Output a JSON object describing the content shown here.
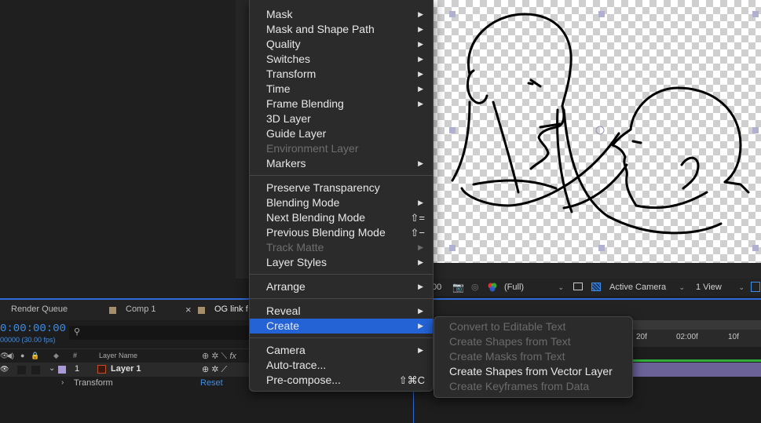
{
  "menu": {
    "groups": [
      {
        "items": [
          {
            "label": "Mask",
            "submenu": true,
            "disabled": false
          },
          {
            "label": "Mask and Shape Path",
            "submenu": true,
            "disabled": false
          },
          {
            "label": "Quality",
            "submenu": true,
            "disabled": false
          },
          {
            "label": "Switches",
            "submenu": true,
            "disabled": false
          },
          {
            "label": "Transform",
            "submenu": true,
            "disabled": false
          },
          {
            "label": "Time",
            "submenu": true,
            "disabled": false
          },
          {
            "label": "Frame Blending",
            "submenu": true,
            "disabled": false
          },
          {
            "label": "3D Layer",
            "submenu": false,
            "disabled": false
          },
          {
            "label": "Guide Layer",
            "submenu": false,
            "disabled": false
          },
          {
            "label": "Environment Layer",
            "submenu": false,
            "disabled": true
          },
          {
            "label": "Markers",
            "submenu": true,
            "disabled": false
          }
        ]
      },
      {
        "items": [
          {
            "label": "Preserve Transparency",
            "submenu": false,
            "disabled": false
          },
          {
            "label": "Blending Mode",
            "submenu": true,
            "disabled": false
          },
          {
            "label": "Next Blending Mode",
            "shortcut": "⇧=",
            "disabled": false
          },
          {
            "label": "Previous Blending Mode",
            "shortcut": "⇧−",
            "disabled": false
          },
          {
            "label": "Track Matte",
            "submenu": true,
            "disabled": true
          },
          {
            "label": "Layer Styles",
            "submenu": true,
            "disabled": false
          }
        ]
      },
      {
        "items": [
          {
            "label": "Arrange",
            "submenu": true,
            "disabled": false
          }
        ]
      },
      {
        "items": [
          {
            "label": "Reveal",
            "submenu": true,
            "disabled": false
          },
          {
            "label": "Create",
            "submenu": true,
            "disabled": false,
            "highlighted": true
          }
        ]
      },
      {
        "items": [
          {
            "label": "Camera",
            "submenu": true,
            "disabled": false
          },
          {
            "label": "Auto-trace...",
            "submenu": false,
            "disabled": false
          },
          {
            "label": "Pre-compose...",
            "shortcut": "⇧⌘C",
            "disabled": false
          }
        ]
      }
    ]
  },
  "submenu": {
    "items": [
      {
        "label": "Convert to Editable Text",
        "disabled": true
      },
      {
        "label": "Create Shapes from Text",
        "disabled": true
      },
      {
        "label": "Create Masks from Text",
        "disabled": true
      },
      {
        "label": "Create Shapes from Vector Layer",
        "disabled": false
      },
      {
        "label": "Create Keyframes from Data",
        "disabled": true
      }
    ]
  },
  "viewer_bar": {
    "partial_value": "00",
    "resolution": "(Full)",
    "camera": "Active Camera",
    "views": "1 View"
  },
  "panel_tabs": {
    "render_queue": "Render Queue",
    "comp1": "Comp 1",
    "close": "×",
    "og_tab": "OG link f"
  },
  "timeline": {
    "timecode": "0:00:00:00",
    "fps": "00000 (30.00 fps)",
    "col_number": "#",
    "col_layer_name": "Layer Name",
    "layer_number": "1",
    "layer_name": "Layer 1",
    "transform_label": "Transform",
    "reset_label": "Reset",
    "ruler": [
      "20f",
      "02:00f",
      "10f"
    ]
  },
  "colors": {
    "accent": "#2463d5",
    "timecode": "#3d8ee8",
    "track": "#6b6298",
    "label_swatch": "#a58e6a"
  }
}
